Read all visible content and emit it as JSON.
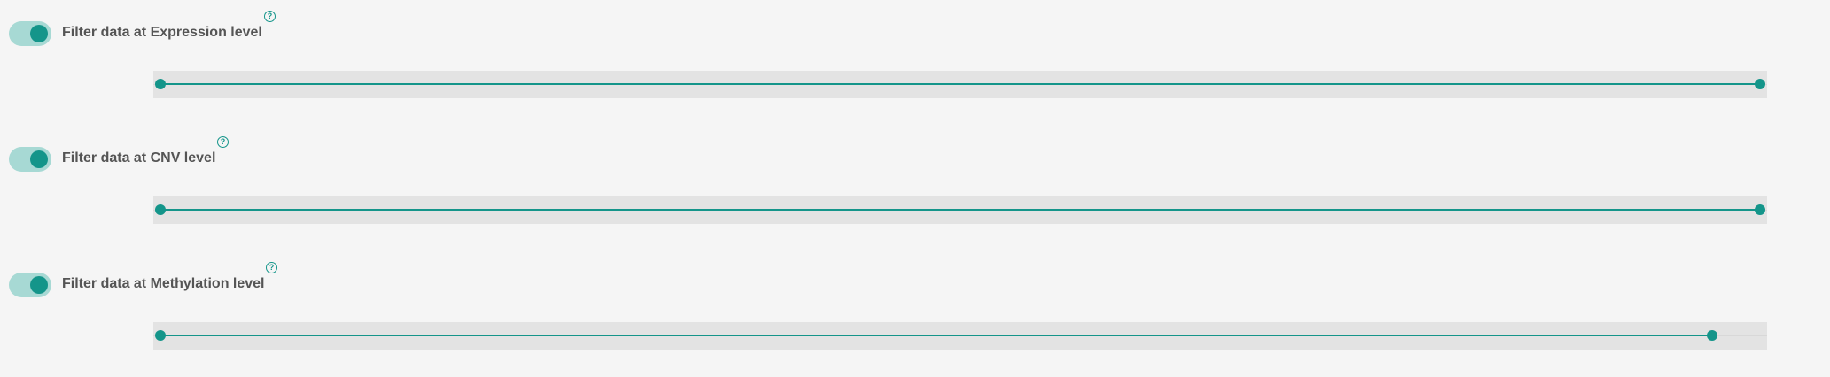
{
  "colors": {
    "accent": "#14958a",
    "toggle_track": "#a7d9d4",
    "slider_bg": "#e3e3e3",
    "label": "#555555",
    "page_bg": "#f5f5f5"
  },
  "filters": [
    {
      "label": "Filter data at Expression level",
      "enabled": true,
      "help_icon": "question-circle-icon",
      "help_glyph": "?",
      "range": {
        "low": 0.0,
        "high": 1.0
      }
    },
    {
      "label": "Filter data at CNV level",
      "enabled": true,
      "help_icon": "question-circle-icon",
      "help_glyph": "?",
      "range": {
        "low": 0.0,
        "high": 1.0
      }
    },
    {
      "label": "Filter data at Methylation level",
      "enabled": true,
      "help_icon": "question-circle-icon",
      "help_glyph": "?",
      "range": {
        "low": 0.0,
        "high": 0.97
      }
    }
  ]
}
